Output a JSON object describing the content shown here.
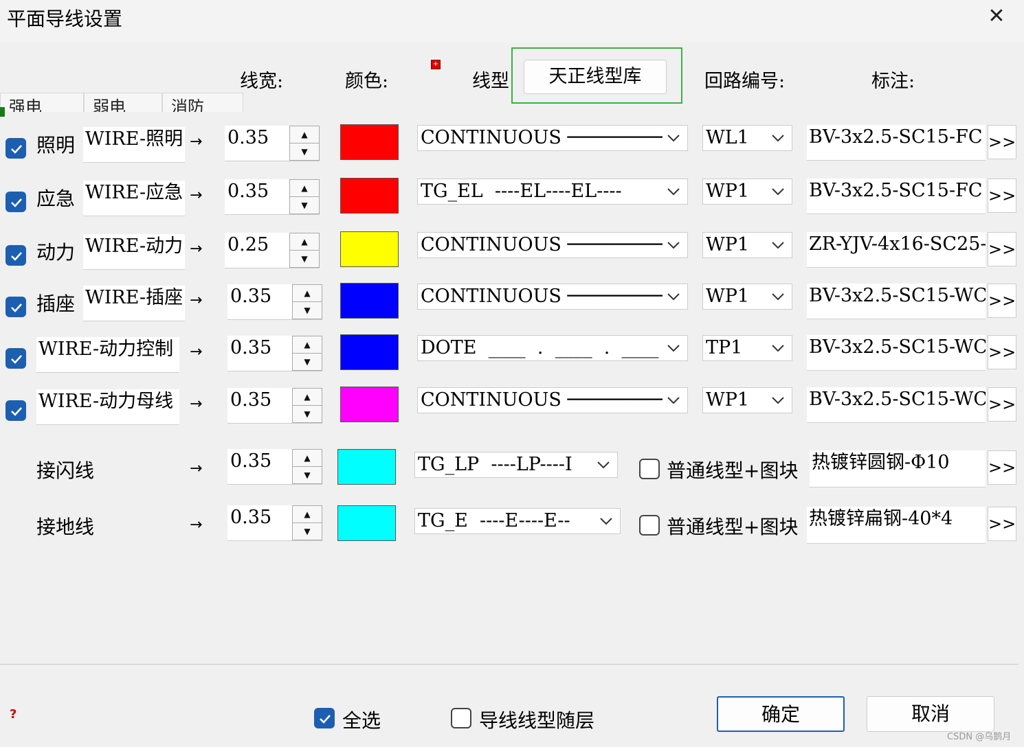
{
  "window": {
    "title": "平面导线设置",
    "close_label": "✕"
  },
  "headers": {
    "width": "线宽:",
    "color": "颜色:",
    "linetype": "线型",
    "library_button": "天正线型库",
    "circuit": "回路编号:",
    "annotation": "标注:"
  },
  "tabs": [
    "强电",
    "弱电",
    "消防"
  ],
  "arrow": "→",
  "more_label": ">>",
  "rows": [
    {
      "checked": true,
      "name": "照明",
      "layer": "WIRE-照明",
      "width": "0.35",
      "color": "#ff0000",
      "linetype": "CONTINUOUS ───────────",
      "circuit": "WL1",
      "annotation": "BV-3x2.5-SC15-FC"
    },
    {
      "checked": true,
      "name": "应急",
      "layer": "WIRE-应急",
      "width": "0.35",
      "color": "#ff0000",
      "linetype": "TG_EL  ----EL----EL----",
      "circuit": "WP1",
      "annotation": "BV-3x2.5-SC15-FC"
    },
    {
      "checked": true,
      "name": "动力",
      "layer": "WIRE-动力",
      "width": "0.25",
      "color": "#ffff00",
      "linetype": "CONTINUOUS ───────────",
      "circuit": "WP1",
      "annotation": "ZR-YJV-4x16-SC25-"
    },
    {
      "checked": true,
      "name": "插座",
      "layer": "WIRE-插座",
      "width": "0.35",
      "color": "#0000ff",
      "linetype": "CONTINUOUS ───────────",
      "circuit": "WP1",
      "annotation": "BV-3x2.5-SC15-WC"
    },
    {
      "checked": true,
      "name": "",
      "layer": "WIRE-动力控制",
      "width": "0.35",
      "color": "#0000ff",
      "linetype": "DOTE  ____  .  ____  .  ____",
      "circuit": "TP1",
      "annotation": "BV-3x2.5-SC15-WC"
    },
    {
      "checked": true,
      "name": "",
      "layer": "WIRE-动力母线",
      "width": "0.35",
      "color": "#ff00ff",
      "linetype": "CONTINUOUS ───────────",
      "circuit": "WP1",
      "annotation": "BV-3x2.5-SC15-WC"
    }
  ],
  "special_rows": [
    {
      "name": "接闪线",
      "width": "0.35",
      "color": "#00ffff",
      "linetype": "TG_LP  ----LP----I",
      "option_label": "普通线型+图块",
      "option_checked": false,
      "annotation": "热镀锌圆钢-Φ10"
    },
    {
      "name": "接地线",
      "width": "0.35",
      "color": "#00ffff",
      "linetype": "TG_E  ----E----E--",
      "option_label": "普通线型+图块",
      "option_checked": false,
      "annotation": "热镀锌扁钢-40*4"
    }
  ],
  "footer": {
    "help": "?",
    "select_all_label": "全选",
    "select_all_checked": true,
    "follow_layer_label": "导线线型随层",
    "follow_layer_checked": false,
    "ok_label": "确定",
    "cancel_label": "取消"
  },
  "watermark": "CSDN @乌鹊月"
}
